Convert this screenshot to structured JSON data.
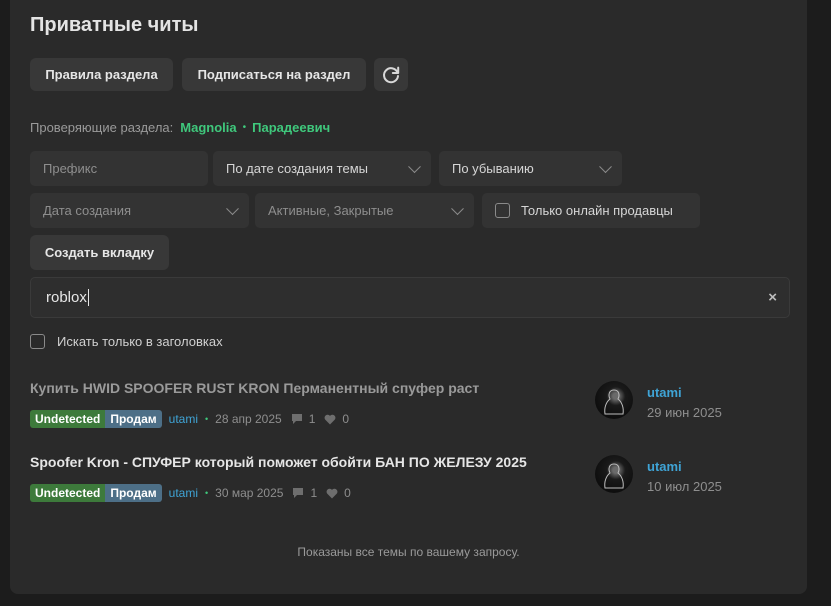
{
  "page": {
    "title": "Приватные читы"
  },
  "actions": {
    "rules": "Правила раздела",
    "subscribe": "Подписаться на раздел"
  },
  "moderators": {
    "label": "Проверяющие раздела:",
    "names": [
      "Magnolia",
      "Парадеевич"
    ],
    "separator": "•"
  },
  "filters": {
    "prefix_placeholder": "Префикс",
    "sort_by": "По дате создания темы",
    "sort_order": "По убыванию",
    "date_placeholder": "Дата создания",
    "state": "Активные, Закрытые",
    "online_sellers": "Только онлайн продавцы",
    "create_tab": "Создать вкладку"
  },
  "search": {
    "value": "roblox",
    "clear": "×",
    "titles_only": "Искать только в заголовках"
  },
  "threads": [
    {
      "title": "Купить HWID SPOOFER RUST KRON Перманентный спуфер раст",
      "tags": [
        "Undetected",
        "Продам"
      ],
      "author": "utami",
      "date": "28 апр 2025",
      "replies": "1",
      "likes": "0",
      "last_user": "utami",
      "last_date": "29 июн 2025",
      "read": true
    },
    {
      "title": "Spoofer Kron - СПУФЕР который поможет обойти БАН ПО ЖЕЛЕЗУ 2025",
      "tags": [
        "Undetected",
        "Продам"
      ],
      "author": "utami",
      "date": "30 мар 2025",
      "replies": "1",
      "likes": "0",
      "last_user": "utami",
      "last_date": "10 июл 2025",
      "read": false
    }
  ],
  "colors": {
    "accent_green": "#3fc87c",
    "link_blue": "#3fa4d6",
    "tag_green": "#3d7a3b",
    "tag_blue": "#4d6f87"
  },
  "meta_dot": "•",
  "footer": {
    "note": "Показаны все темы по вашему запросу."
  }
}
